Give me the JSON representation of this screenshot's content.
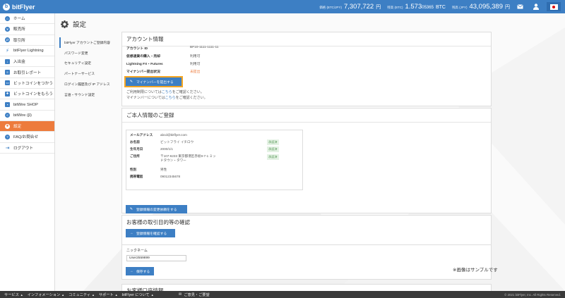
{
  "app": {
    "brand": "bitFlyer"
  },
  "rates": [
    {
      "label": "価格 (BTC/JPY)",
      "value": "7,307,722",
      "unit": "円"
    },
    {
      "label": "残高 (BTC)",
      "value": "1.573",
      "value_small": "05365",
      "unit": "BTC"
    },
    {
      "label": "残高 (JPY)",
      "value": "43,095,389",
      "unit": "円"
    }
  ],
  "topbar_icons": [
    "mail-icon",
    "user-icon",
    "flag-icon"
  ],
  "sidebar": {
    "items": [
      {
        "label": "ホーム",
        "icon": "home-icon"
      },
      {
        "label": "販売所",
        "icon": "shop-icon"
      },
      {
        "label": "取引所",
        "icon": "exchange-icon"
      },
      {
        "label": "bitFlyer Lightning",
        "icon": "lightning-icon"
      },
      {
        "label": "入出金",
        "icon": "deposit-icon"
      },
      {
        "label": "お取引レポート",
        "icon": "report-icon"
      },
      {
        "label": "ビットコインをつかう",
        "icon": "card-icon"
      },
      {
        "label": "ビットコインをもらう",
        "icon": "gift-icon"
      },
      {
        "label": "bitWire SHOP",
        "icon": "cart-icon"
      },
      {
        "label": "bitWire (β)",
        "icon": "share-icon"
      },
      {
        "label": "設定",
        "icon": "gear-icon",
        "active": true
      },
      {
        "label": "FAQ/お問合せ",
        "icon": "question-icon"
      },
      {
        "label": "ログアウト",
        "icon": "logout-icon"
      }
    ]
  },
  "page": {
    "title": "設定"
  },
  "subnav": {
    "items": [
      {
        "label": "bitFlyer アカウントご登録内容",
        "active": true
      },
      {
        "label": "パスワード変更"
      },
      {
        "label": "セキュリティ設定"
      },
      {
        "label": "パートナーサービス"
      },
      {
        "label": "ログイン履歴及び IP アドレス"
      },
      {
        "label": "言語・サウンド設定"
      }
    ]
  },
  "account": {
    "title": "アカウント情報",
    "rows": [
      {
        "key": "アカウント ID",
        "value": "BF10-1111-1111-11"
      },
      {
        "key": "仮想通貨の購入・売却",
        "value": "利用可"
      },
      {
        "key": "Lightning FX・Futures",
        "value": "利用可"
      },
      {
        "key": "マイナンバー提出状況",
        "value": "未提出"
      }
    ],
    "submit_button": "マイナンバーを提出する",
    "note1_prefix": "ご利用制限については",
    "note1_link": "こちら",
    "note1_suffix": "をご確認ください。",
    "note2_prefix": "マイナンバーについては",
    "note2_link": "こちら",
    "note2_suffix": "をご確認ください。"
  },
  "personal": {
    "title": "ご本人情報のご登録",
    "rows": [
      {
        "key": "メールアドレス",
        "value": "abcd@bitflyer.com"
      },
      {
        "key": "お名前",
        "value": "ビットフライ イチロウ",
        "badge": "承認済"
      },
      {
        "key": "生年月日",
        "value": "2000/1/1",
        "badge": "承認済"
      },
      {
        "key": "ご住所",
        "value": "〒107-6233 東京都港区赤坂9-7-1 ミッドタウン・タワー",
        "badge": "承認済"
      },
      {
        "key": "性別",
        "value": "男性"
      },
      {
        "key": "携帯電話",
        "value": "09012345678"
      }
    ],
    "change_button": "登録情報の変更依頼をする"
  },
  "purpose": {
    "title": "お客様の取引目的等の確認",
    "confirm_button": "登録情報を確認する"
  },
  "nickname": {
    "label": "ニックネーム",
    "value": "User2559899",
    "save_button": "保存する"
  },
  "bank": {
    "title": "お客様口座情報"
  },
  "sample_note": "※画像はサンプルです",
  "footer": {
    "items": [
      "サービス",
      "インフォメーション",
      "コミュニティ",
      "サポート",
      "bitFlyer について"
    ],
    "contact": "ご意見・ご要望",
    "copyright": "© 2021 bitFlyer, Inc. All Rights Reserved."
  }
}
